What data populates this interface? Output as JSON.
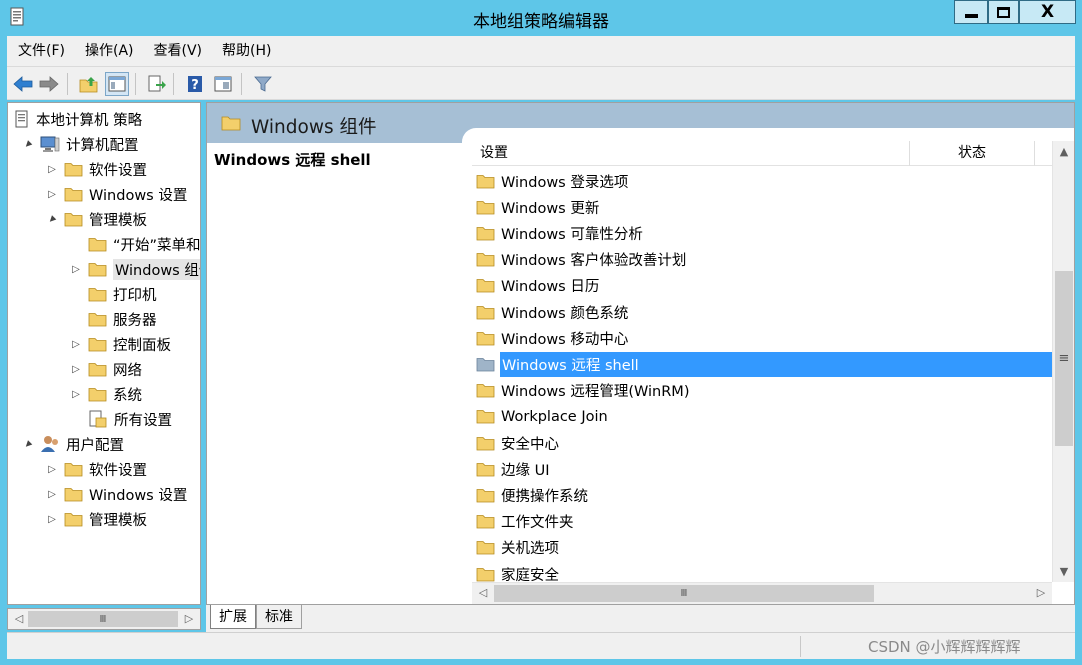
{
  "window": {
    "title": "本地组策略编辑器",
    "close_glyph": "X"
  },
  "menu": {
    "items": [
      "文件(F)",
      "操作(A)",
      "查看(V)",
      "帮助(H)"
    ]
  },
  "toolbar": {
    "buttons": [
      "back-arrow-icon",
      "forward-arrow-icon",
      "up-folder-icon",
      "show-hide-tree-icon",
      "export-list-icon",
      "help-icon",
      "extended-view-icon",
      "filter-icon"
    ]
  },
  "tree": {
    "items": [
      {
        "label": "本地计算机 策略",
        "icon": "policy-doc-icon",
        "expander": ""
      },
      {
        "label": "计算机配置",
        "icon": "computer-icon",
        "expander": "▲"
      },
      {
        "label": "软件设置",
        "icon": "folder-icon",
        "expander": "▷"
      },
      {
        "label": "Windows 设置",
        "icon": "folder-icon",
        "expander": "▷"
      },
      {
        "label": "管理模板",
        "icon": "folder-icon",
        "expander": "▲"
      },
      {
        "label": "“开始”菜单和",
        "icon": "folder-icon",
        "expander": ""
      },
      {
        "label": "Windows 组件",
        "icon": "folder-icon",
        "expander": "▷"
      },
      {
        "label": "打印机",
        "icon": "folder-icon",
        "expander": ""
      },
      {
        "label": "服务器",
        "icon": "folder-icon",
        "expander": ""
      },
      {
        "label": "控制面板",
        "icon": "folder-icon",
        "expander": "▷"
      },
      {
        "label": "网络",
        "icon": "folder-icon",
        "expander": "▷"
      },
      {
        "label": "系统",
        "icon": "folder-icon",
        "expander": "▷"
      },
      {
        "label": "所有设置",
        "icon": "all-settings-icon",
        "expander": ""
      },
      {
        "label": "用户配置",
        "icon": "user-icon",
        "expander": "▲"
      },
      {
        "label": "软件设置",
        "icon": "folder-icon",
        "expander": "▷"
      },
      {
        "label": "Windows 设置",
        "icon": "folder-icon",
        "expander": "▷"
      },
      {
        "label": "管理模板",
        "icon": "folder-icon",
        "expander": "▷"
      }
    ]
  },
  "right": {
    "header_title": "Windows 组件",
    "description_title": "Windows 远程 shell",
    "columns": [
      "设置",
      "状态"
    ],
    "rows": [
      "Windows 登录选项",
      "Windows 更新",
      "Windows 可靠性分析",
      "Windows 客户体验改善计划",
      "Windows 日历",
      "Windows 颜色系统",
      "Windows 移动中心",
      "Windows 远程 shell",
      "Windows 远程管理(WinRM)",
      "Workplace Join",
      "安全中心",
      "边缘 UI",
      "便携操作系统",
      "工作文件夹",
      "关机选项",
      "家庭安全"
    ],
    "selected_row": "Windows 远程 shell"
  },
  "tabs": {
    "items": [
      "扩展",
      "标准"
    ],
    "active": "扩展"
  },
  "scroll": {
    "up": "▲",
    "down": "▼",
    "left": "◁",
    "right": "▷",
    "grip_v": "≡",
    "grip_h": "Ⅲ"
  },
  "watermark": "CSDN @小辉辉辉辉辉",
  "colors": {
    "title_bar": "#5ec6e8",
    "selection": "#3399ff",
    "header_band": "#a6bfd5",
    "folder": "#f3cf6b"
  }
}
